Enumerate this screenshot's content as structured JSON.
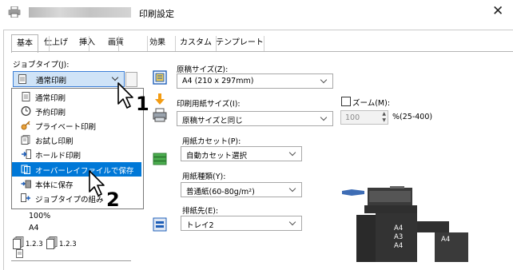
{
  "window": {
    "title": "印刷設定",
    "blurred_title_placeholder": ""
  },
  "tabs": [
    {
      "label": "基本"
    },
    {
      "label": "仕上げ"
    },
    {
      "label": "挿入"
    },
    {
      "label": "画質"
    },
    {
      "label": "効果"
    },
    {
      "label": "カスタム"
    },
    {
      "label": "テンプレート"
    }
  ],
  "job_type": {
    "label": "ジョブタイプ(J):",
    "value": "通常印刷",
    "options": [
      {
        "label": "通常印刷",
        "icon": "document-icon"
      },
      {
        "label": "予約印刷",
        "icon": "clock-icon"
      },
      {
        "label": "プライベート印刷",
        "icon": "key-icon"
      },
      {
        "label": "お試し印刷",
        "icon": "proof-icon"
      },
      {
        "label": "ホールド印刷",
        "icon": "hold-icon"
      },
      {
        "label": "オーバーレイファイルで保存",
        "icon": "overlay-icon"
      },
      {
        "label": "本体に保存",
        "icon": "save-to-device-icon"
      },
      {
        "label": "ジョブタイプの組み",
        "icon": "combine-icon"
      }
    ],
    "highlighted_index": 5
  },
  "preview": {
    "zoom": "100%",
    "paper": "A4",
    "collate_a": "1.2.3",
    "collate_b": "1.2.3"
  },
  "original_size": {
    "label": "原稿サイズ(Z):",
    "value": "A4 (210 x 297mm)"
  },
  "print_paper_size": {
    "label": "印刷用紙サイズ(I):",
    "value": "原稿サイズと同じ"
  },
  "zoom": {
    "label": "ズーム(M):",
    "value": "100",
    "range": "%(25-400)",
    "checked": false
  },
  "paper_source": {
    "label": "用紙カセット(P):",
    "value": "自動カセット選択"
  },
  "paper_type": {
    "label": "用紙種類(Y):",
    "value": "普通紙(60-80g/m²)"
  },
  "output_tray": {
    "label": "排紙先(E):",
    "value": "トレイ2"
  },
  "printer_image": {
    "tray_labels": [
      "A4",
      "A3",
      "A4"
    ],
    "side_label": "A4"
  },
  "annotations": {
    "step1": "1",
    "step2": "2"
  }
}
